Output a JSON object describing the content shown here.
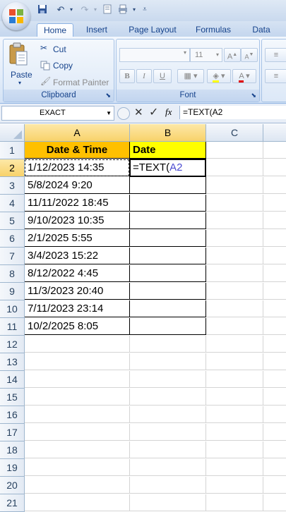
{
  "ribbon": {
    "tabs": [
      "Home",
      "Insert",
      "Page Layout",
      "Formulas",
      "Data"
    ],
    "clipboard": {
      "paste_label": "Paste",
      "cut_label": "Cut",
      "copy_label": "Copy",
      "format_painter_label": "Format Painter",
      "group_label": "Clipboard"
    },
    "font": {
      "size": "11",
      "bold": "B",
      "italic": "I",
      "underline": "U",
      "group_label": "Font"
    }
  },
  "formula_bar": {
    "name_box": "EXACT",
    "fx": "fx",
    "formula": "=TEXT(A2"
  },
  "columns": [
    "A",
    "B",
    "C"
  ],
  "rows": [
    "1",
    "2",
    "3",
    "4",
    "5",
    "6",
    "7",
    "8",
    "9",
    "10",
    "11",
    "12",
    "13",
    "14",
    "15",
    "16",
    "17",
    "18",
    "19",
    "20",
    "21"
  ],
  "sheet": {
    "header_a": "Date & Time",
    "header_b": "Date",
    "a_values": [
      "1/12/2023 14:35",
      "5/8/2024 9:20",
      "11/11/2022 18:45",
      "9/10/2023 10:35",
      "2/1/2025 5:55",
      "3/4/2023 15:22",
      "8/12/2022 4:45",
      "11/3/2023 20:40",
      "7/11/2023 23:14",
      "10/2/2025 8:05"
    ],
    "b2_prefix": "=TEXT(",
    "b2_ref": "A2"
  },
  "colors": {
    "header_a_fill": "#ffc000",
    "header_b_fill": "#ffff00",
    "ref_color": "#4b4bd1"
  }
}
